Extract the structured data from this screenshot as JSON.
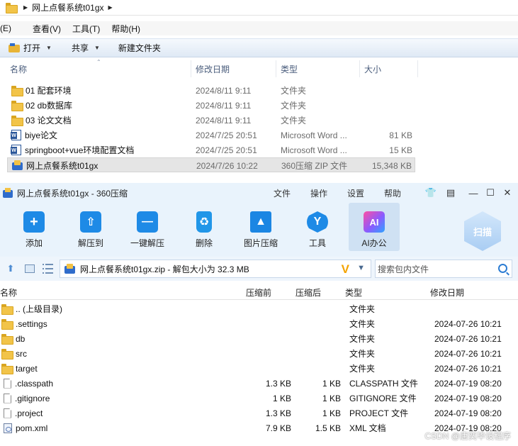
{
  "explorer": {
    "breadcrumb": "网上点餐系统t01gx",
    "menu": [
      "(E)",
      "查看(V)",
      "工具(T)",
      "帮助(H)"
    ],
    "toolbar": {
      "open": "打开",
      "share": "共享",
      "new_folder": "新建文件夹"
    },
    "columns": {
      "name": "名称",
      "date": "修改日期",
      "type": "类型",
      "size": "大小"
    },
    "rows": [
      {
        "name": "01 配套环境",
        "date": "2024/8/11 9:11",
        "type": "文件夹",
        "size": "",
        "icon": "folder-icon"
      },
      {
        "name": "02 db数据库",
        "date": "2024/8/11 9:11",
        "type": "文件夹",
        "size": "",
        "icon": "folder-icon"
      },
      {
        "name": "03 论文文档",
        "date": "2024/8/11 9:11",
        "type": "文件夹",
        "size": "",
        "icon": "folder-icon"
      },
      {
        "name": "biye论文",
        "date": "2024/7/25 20:51",
        "type": "Microsoft Word ...",
        "size": "81 KB",
        "icon": "word-icon"
      },
      {
        "name": "springboot+vue环境配置文档",
        "date": "2024/7/25 20:51",
        "type": "Microsoft Word ...",
        "size": "15 KB",
        "icon": "word-icon"
      },
      {
        "name": "网上点餐系统t01gx",
        "date": "2024/7/26 10:22",
        "type": "360压缩 ZIP 文件",
        "size": "15,348 KB",
        "icon": "zip-icon",
        "selected": true
      }
    ]
  },
  "zip": {
    "title": "网上点餐系统t01gx - 360压缩",
    "menu": [
      "文件",
      "操作",
      "设置",
      "帮助"
    ],
    "ribbon": [
      {
        "label": "添加",
        "icon": "add-icon"
      },
      {
        "label": "解压到",
        "icon": "extract-to-icon"
      },
      {
        "label": "一键解压",
        "icon": "one-click-extract-icon"
      },
      {
        "label": "删除",
        "icon": "trash-icon"
      },
      {
        "label": "图片压缩",
        "icon": "image-compress-icon"
      },
      {
        "label": "工具",
        "icon": "tools-icon"
      },
      {
        "label": "AI办公",
        "icon": "ai-icon",
        "active": true
      }
    ],
    "ai_badge": "AI",
    "scan_label": "扫描",
    "path": "网上点餐系统t01gx.zip - 解包大小为 32.3 MB",
    "search_placeholder": "搜索包内文件",
    "columns": {
      "name": "名称",
      "packed": "压缩前",
      "unpacked": "压缩后",
      "type": "类型",
      "mtime": "修改日期"
    },
    "rows": [
      {
        "name": ".. (上级目录)",
        "packed": "",
        "unpacked": "",
        "type": "文件夹",
        "mtime": "",
        "icon": "folder-icon"
      },
      {
        "name": ".settings",
        "packed": "",
        "unpacked": "",
        "type": "文件夹",
        "mtime": "2024-07-26 10:21",
        "icon": "folder-icon"
      },
      {
        "name": "db",
        "packed": "",
        "unpacked": "",
        "type": "文件夹",
        "mtime": "2024-07-26 10:21",
        "icon": "folder-icon"
      },
      {
        "name": "src",
        "packed": "",
        "unpacked": "",
        "type": "文件夹",
        "mtime": "2024-07-26 10:21",
        "icon": "folder-icon"
      },
      {
        "name": "target",
        "packed": "",
        "unpacked": "",
        "type": "文件夹",
        "mtime": "2024-07-26 10:21",
        "icon": "folder-icon"
      },
      {
        "name": ".classpath",
        "packed": "1.3 KB",
        "unpacked": "1 KB",
        "type": "CLASSPATH 文件",
        "mtime": "2024-07-19 08:20",
        "icon": "file-icon"
      },
      {
        "name": ".gitignore",
        "packed": "1 KB",
        "unpacked": "1 KB",
        "type": "GITIGNORE 文件",
        "mtime": "2024-07-19 08:20",
        "icon": "file-icon"
      },
      {
        "name": ".project",
        "packed": "1.3 KB",
        "unpacked": "1 KB",
        "type": "PROJECT 文件",
        "mtime": "2024-07-19 08:20",
        "icon": "file-icon"
      },
      {
        "name": "pom.xml",
        "packed": "7.9 KB",
        "unpacked": "1.5 KB",
        "type": "XML 文档",
        "mtime": "2024-07-19 08:20",
        "icon": "xml-icon"
      }
    ]
  },
  "watermark": "CSDN @唐奕毕设程序"
}
